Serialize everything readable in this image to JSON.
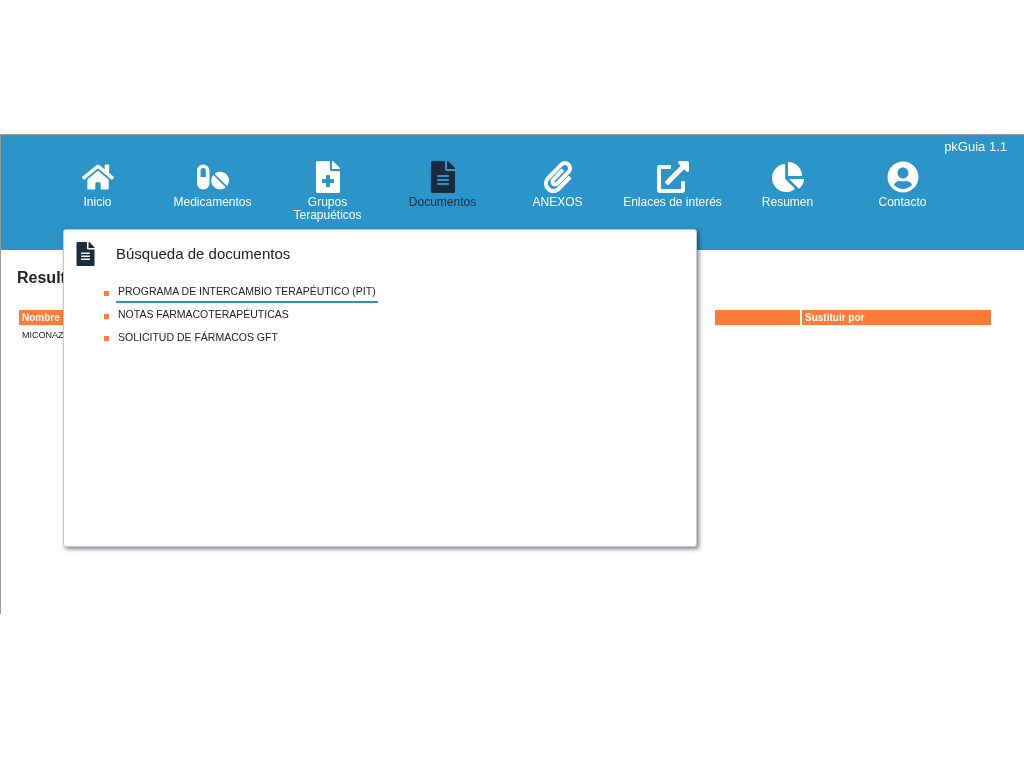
{
  "app": {
    "version": "pkGuia 1.1"
  },
  "nav": [
    {
      "label": "Inicio",
      "selected": false
    },
    {
      "label": "Medicamentos",
      "selected": false
    },
    {
      "label": "Grupos Terapuéticos",
      "selected": false
    },
    {
      "label": "Documentos",
      "selected": true
    },
    {
      "label": "ANEXOS",
      "selected": false
    },
    {
      "label": "Enlaces de interés",
      "selected": false
    },
    {
      "label": "Resumen",
      "selected": false
    },
    {
      "label": "Contacto",
      "selected": false
    }
  ],
  "page": {
    "heading": "Result",
    "table": {
      "columns": [
        "Nombre",
        "Sustituir por"
      ],
      "rows": [
        [
          "MICONAZ"
        ]
      ]
    }
  },
  "dropdown": {
    "title": "Búsqueda de documentos",
    "items": [
      {
        "label": "PROGRAMA DE INTERCAMBIO TERAPÉUTICO (PIT)",
        "selected": true
      },
      {
        "label": "NOTAS FARMACOTERAPÉUTICAS",
        "selected": false
      },
      {
        "label": "SOLICITUD DE FÁRMACOS GFT",
        "selected": false
      }
    ]
  }
}
